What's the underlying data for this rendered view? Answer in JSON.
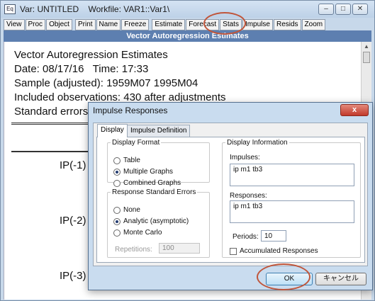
{
  "window": {
    "icon_label": "Eq",
    "title": "Var: UNTITLED    Workfile: VAR1::Var1\\",
    "controls": [
      "–",
      "□",
      "✕"
    ]
  },
  "toolbar": {
    "buttons": [
      "View",
      "Proc",
      "Object",
      "Print",
      "Name",
      "Freeze",
      "Estimate",
      "Forecast",
      "Stats",
      "Impulse",
      "Resids",
      "Zoom"
    ]
  },
  "header_band": "Vector Autoregression Estimates",
  "output": {
    "lines": [
      "Vector Autoregression Estimates",
      "Date: 08/17/16   Time: 17:33",
      "Sample (adjusted): 1959M07 1995M04",
      "Included observations: 430 after adjustments",
      "Standard errors"
    ],
    "rows": [
      "IP(-1)",
      "IP(-2)",
      "IP(-3)"
    ]
  },
  "dialog": {
    "title": "Impulse Responses",
    "close_label": "x",
    "tabs": [
      "Display",
      "Impulse Definition"
    ],
    "display_format": {
      "legend": "Display Format",
      "options": [
        "Table",
        "Multiple Graphs",
        "Combined Graphs"
      ],
      "selected": "Multiple Graphs"
    },
    "response_se": {
      "legend": "Response Standard Errors",
      "options": [
        "None",
        "Analytic (asymptotic)",
        "Monte Carlo"
      ],
      "selected": "Analytic (asymptotic)",
      "repetitions_label": "Repetitions:",
      "repetitions_value": "100"
    },
    "display_info": {
      "legend": "Display Information",
      "impulses_label": "Impulses:",
      "impulses_value": "ip m1 tb3",
      "responses_label": "Responses:",
      "responses_value": "ip m1 tb3",
      "periods_label": "Periods:",
      "periods_value": "10",
      "accumulated_label": "Accumulated Responses",
      "accumulated_checked": false
    },
    "ok_label": "OK",
    "cancel_label": "キャンセル"
  },
  "colors": {
    "header_band": "#5d7fb0",
    "highlight": "#c0553a",
    "window_frame": "#c7d8ea"
  }
}
